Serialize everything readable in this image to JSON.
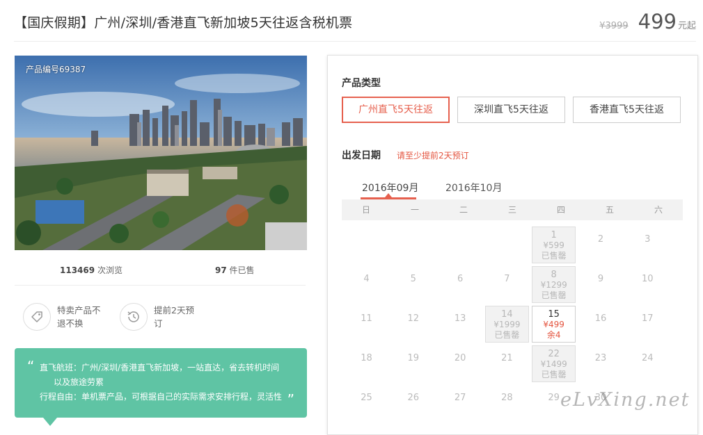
{
  "header": {
    "title": "【国庆假期】广州/深圳/香港直飞新加坡5天往返含税机票",
    "old_price": "¥3999",
    "price": "499",
    "price_unit": "元起"
  },
  "product": {
    "code": "产品编号69387",
    "views_count": "113469",
    "views_label": "次浏览",
    "sold_count": "97",
    "sold_label": "件已售"
  },
  "features": [
    {
      "icon": "tag-icon",
      "text": "特卖产品不退不换"
    },
    {
      "icon": "clock-history-icon",
      "text": "提前2天预订"
    }
  ],
  "description": {
    "line1": "直飞航班：广州/深圳/香港直飞新加坡，一站直达，省去转机时间",
    "line2": "以及旅途劳累",
    "line3": "行程自由：单机票产品，可根据自己的实际需求安排行程，灵活性"
  },
  "booking": {
    "type_label": "产品类型",
    "types": [
      "广州直飞5天往返",
      "深圳直飞5天往返",
      "香港直飞5天往返"
    ],
    "active_type": 0,
    "date_label": "出发日期",
    "date_tip": "请至少提前2天预订",
    "months": [
      "2016年09月",
      "2016年10月"
    ],
    "weekdays": [
      "日",
      "一",
      "二",
      "三",
      "四",
      "五",
      "六"
    ],
    "days": [
      {
        "day": "1",
        "price": "¥599",
        "status": "已售罄"
      },
      {
        "day": "2"
      },
      {
        "day": "3"
      },
      {
        "day": "4"
      },
      {
        "day": "5"
      },
      {
        "day": "6"
      },
      {
        "day": "7"
      },
      {
        "day": "8",
        "price": "¥1299",
        "status": "已售罄"
      },
      {
        "day": "9"
      },
      {
        "day": "10"
      },
      {
        "day": "11"
      },
      {
        "day": "12"
      },
      {
        "day": "13"
      },
      {
        "day": "14",
        "price": "¥1999",
        "status": "已售罄"
      },
      {
        "day": "15",
        "price": "¥499",
        "status": "余4"
      },
      {
        "day": "16"
      },
      {
        "day": "17"
      },
      {
        "day": "18"
      },
      {
        "day": "19"
      },
      {
        "day": "20"
      },
      {
        "day": "21"
      },
      {
        "day": "22",
        "price": "¥1499",
        "status": "已售罄"
      },
      {
        "day": "23"
      },
      {
        "day": "24"
      },
      {
        "day": "25"
      },
      {
        "day": "26"
      },
      {
        "day": "27"
      },
      {
        "day": "28"
      },
      {
        "day": "29"
      },
      {
        "day": "30"
      }
    ]
  },
  "watermark": "eLvXing.net",
  "colors": {
    "accent": "#e6604e",
    "green": "#5fc4a4"
  }
}
